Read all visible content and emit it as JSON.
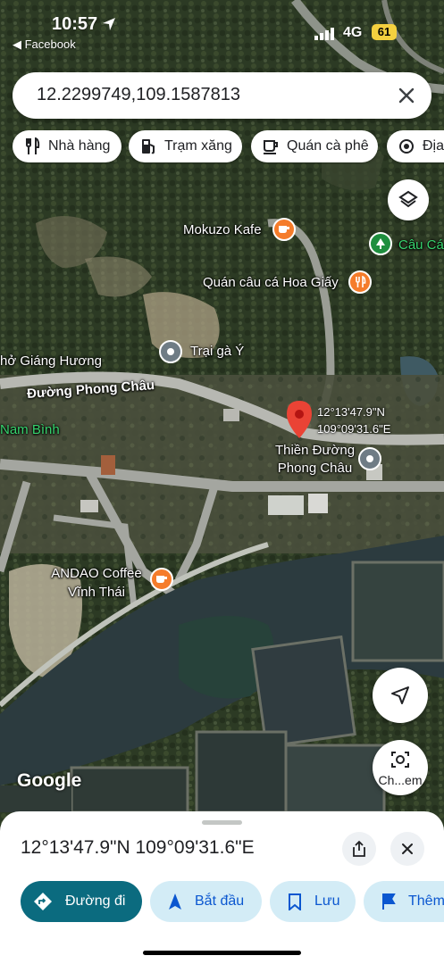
{
  "status_bar": {
    "time": "10:57",
    "back_label": "◀ Facebook",
    "network": "4G",
    "battery": "61"
  },
  "search": {
    "value": "12.2299749,109.1587813"
  },
  "chips": [
    {
      "label": "Nhà hàng",
      "icon": "restaurant-icon"
    },
    {
      "label": "Trạm xăng",
      "icon": "gas-station-icon"
    },
    {
      "label": "Quán cà phê",
      "icon": "coffee-icon"
    },
    {
      "label": "Địa",
      "icon": "settings-icon"
    }
  ],
  "map": {
    "places": [
      {
        "name": "Mokuzo Kafe",
        "icon": "coffee-icon",
        "color": "#f57c2b"
      },
      {
        "name": "Câu Cá",
        "icon": "park-icon",
        "color": "#1e8e3e"
      },
      {
        "name": "Quán câu cá Hoa Giấy",
        "icon": "restaurant-icon",
        "color": "#f57c2b"
      },
      {
        "name": "Trại gà Ý",
        "icon": "place-icon",
        "color": "#6f7c85"
      },
      {
        "name": "hở Giáng Hương",
        "icon": "none",
        "color": "#ffffff"
      },
      {
        "name": "Đường Phong Châu",
        "icon": "road-label",
        "color": "#ffffff"
      },
      {
        "name": "Nam Bình",
        "icon": "none",
        "color": "#37d46e"
      },
      {
        "name": "Thiền Đường Phong Châu",
        "icon": "place-icon",
        "color": "#6f7c85"
      },
      {
        "name": "ANDAO Coffee Vĩnh Thái",
        "icon": "coffee-icon",
        "color": "#f57c2b"
      }
    ],
    "pin_coords": [
      "12°13'47.9\"N",
      "109°09'31.6\"E"
    ],
    "attribution": "Google",
    "pin_color": "#ea4335"
  },
  "controls": {
    "camera_label": "Ch...em"
  },
  "sheet": {
    "title": "12°13'47.9\"N 109°09'31.6\"E",
    "actions": [
      {
        "label": "Đường đi",
        "icon": "directions-icon"
      },
      {
        "label": "Bắt đầu",
        "icon": "navigation-icon"
      },
      {
        "label": "Lưu",
        "icon": "bookmark-icon"
      },
      {
        "label": "Thêm",
        "icon": "flag-icon"
      }
    ]
  }
}
